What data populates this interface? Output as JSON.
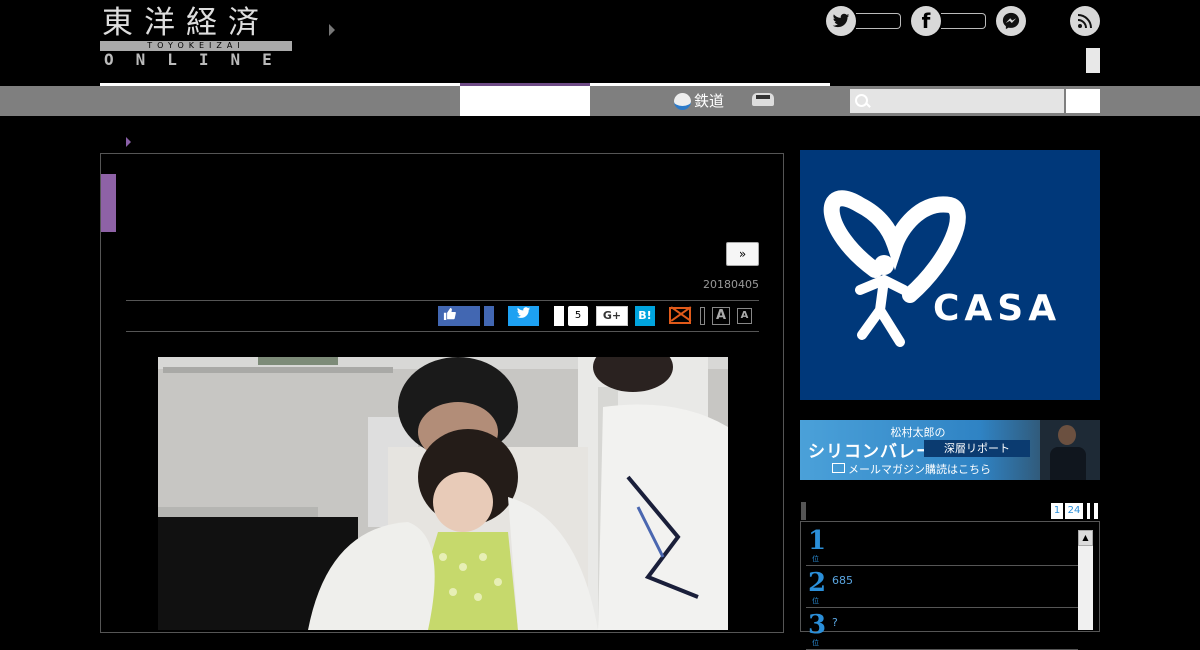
{
  "header": {
    "logo_kanji": "東洋経済",
    "logo_romaji": "TOYOKEIZAI",
    "logo_online": "ONLINE"
  },
  "social": [
    {
      "icon": "twitter-icon",
      "glyph": "t"
    },
    {
      "icon": "facebook-icon",
      "glyph": "f"
    },
    {
      "icon": "messenger-icon",
      "glyph": "m"
    },
    {
      "icon": "rss-icon",
      "glyph": "r"
    }
  ],
  "nav": {
    "rail_label": "鉄道",
    "search_placeholder": ""
  },
  "article": {
    "next_label": "»",
    "date": "20180405",
    "share": {
      "pocket_count": "5",
      "gplus_label": "G+",
      "hatena_label": "B!",
      "font_large": "A",
      "font_small": "A"
    }
  },
  "sidebar": {
    "ad1": {
      "brand": "CASA",
      "registered": "®"
    },
    "ad2": {
      "top": "松村太郎の",
      "main": "シリコンバレー",
      "badge": "深層リポート",
      "sub": "メールマガジン購読はこちら"
    },
    "ranking": {
      "tabs": [
        "1",
        "24"
      ],
      "rows": [
        {
          "rank": "1",
          "suffix": "位",
          "text": ""
        },
        {
          "rank": "2",
          "suffix": "位",
          "text": "685"
        },
        {
          "rank": "3",
          "suffix": "位",
          "text": "?"
        }
      ]
    }
  },
  "colors": {
    "accent_purple": "#8e62a6",
    "ranking_blue": "#2b8fd9",
    "nav_gray": "#7f7f7f",
    "casa_blue": "#00387a"
  }
}
